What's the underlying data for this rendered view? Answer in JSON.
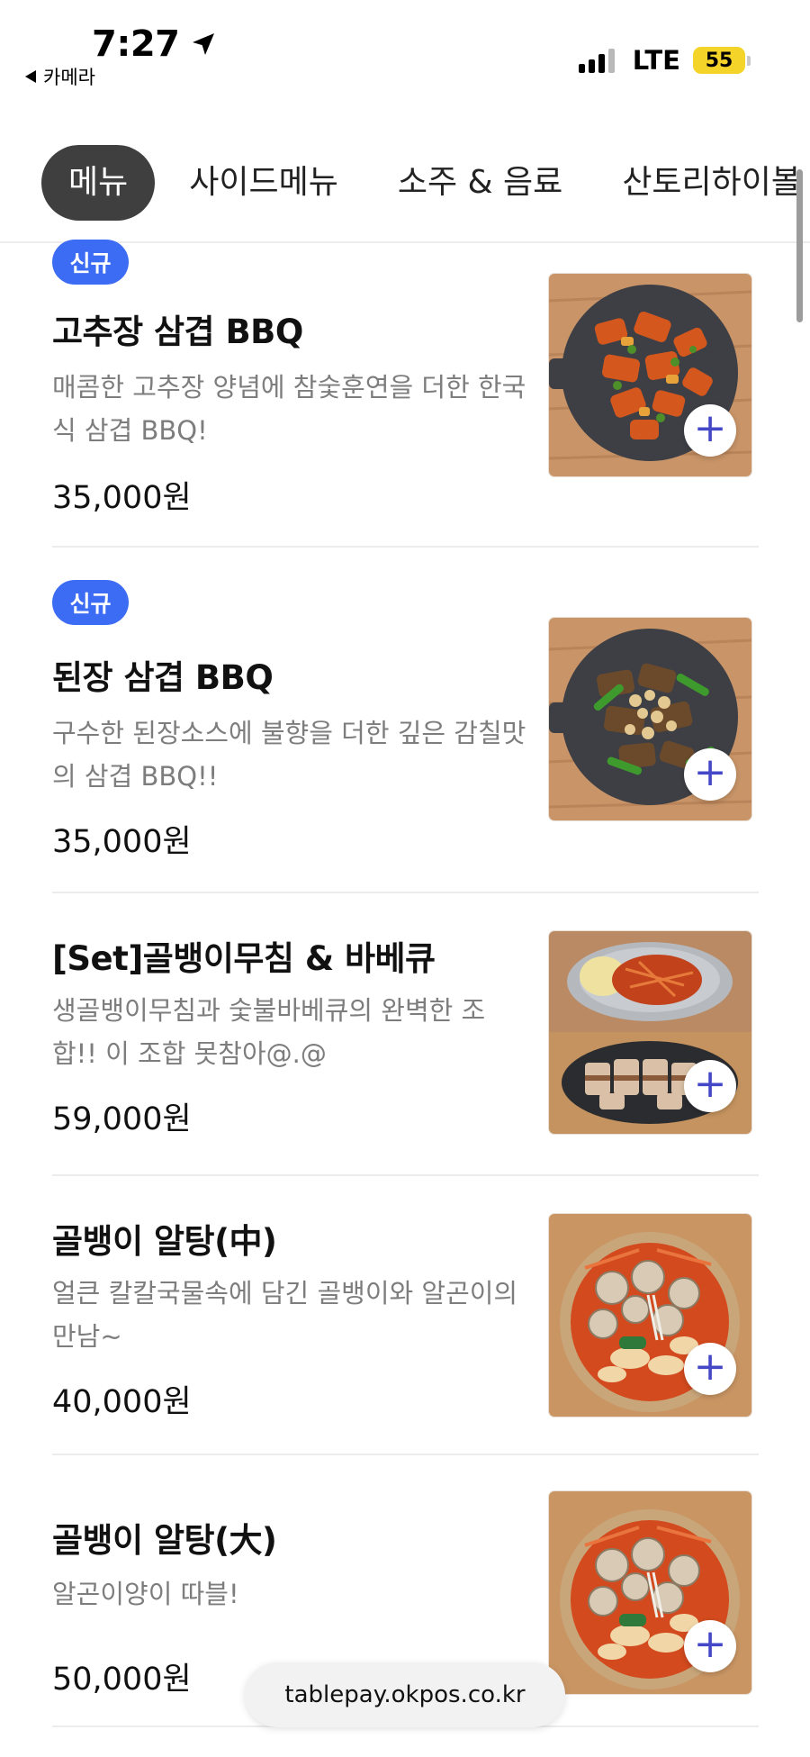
{
  "status_bar": {
    "time": "7:27",
    "back_label": "카메라",
    "network": "LTE",
    "battery": "55",
    "battery_color": "#f4d429"
  },
  "tabs": [
    {
      "label": "메뉴",
      "active": true
    },
    {
      "label": "사이드메뉴",
      "active": false
    },
    {
      "label": "소주 & 음료",
      "active": false
    },
    {
      "label": "산토리하이볼",
      "active": false
    }
  ],
  "menu_items": [
    {
      "badge": "신규",
      "name": "고추장 삼겹 BBQ",
      "description": "매콤한 고추장 양념에 참숯훈연을 더한 한국식 삼겹 BBQ!",
      "price": "35,000원",
      "image": "gochujang-pork-bbq-image",
      "add_icon": "+"
    },
    {
      "badge": "신규",
      "name": "된장 삼겹 BBQ",
      "description": "구수한 된장소스에 불향을 더한 깊은 감칠맛의 삼겹 BBQ!!",
      "price": "35,000원",
      "image": "doenjang-pork-bbq-image",
      "add_icon": "+"
    },
    {
      "name": "[Set]골뱅이무침 & 바베큐",
      "description": "생골뱅이무침과 숯불바베큐의 완벽한 조합!! 이 조합 못참아@.@",
      "price": "59,000원",
      "image": "whelk-salad-bbq-set-image",
      "add_icon": "+"
    },
    {
      "name": "골뱅이 알탕(中)",
      "description": "얼큰 칼칼국물속에 담긴 골뱅이와 알곤이의 만남~",
      "price": "40,000원",
      "image": "whelk-roe-stew-medium-image",
      "add_icon": "+"
    },
    {
      "name": "골뱅이 알탕(大)",
      "description": "알곤이양이 따블!",
      "price": "50,000원",
      "image": "whelk-roe-stew-large-image",
      "add_icon": "+"
    }
  ],
  "url_bar": {
    "url": "tablepay.okpos.co.kr"
  },
  "colors": {
    "badge": "#3d6cf4",
    "active_tab": "#3f3f3f",
    "add_icon": "#4548c6",
    "description": "#7d7d7d"
  }
}
